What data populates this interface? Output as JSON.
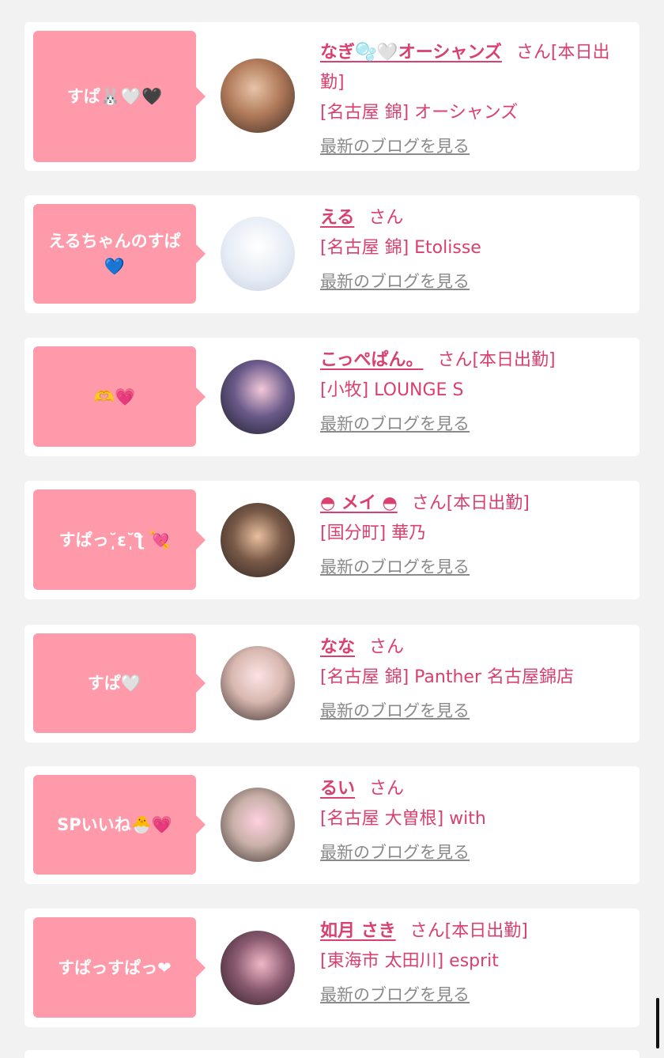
{
  "items": [
    {
      "bubble": "すぱ🐰🤍🖤",
      "name": "なぎ🫧🤍オーシャンズ",
      "san": "さん[本日出勤]",
      "shop": "[名古屋 錦] オーシャンズ",
      "blog": "最新のブログを見る"
    },
    {
      "bubble": "えるちゃんのすぱ💙",
      "name": "える",
      "san": "さん",
      "shop": "[名古屋 錦] Etolisse",
      "blog": "最新のブログを見る"
    },
    {
      "bubble": "🫶💗",
      "name": "こっぺぱん。",
      "san": "さん[本日出勤]",
      "shop": "[小牧] LOUNGE S",
      "blog": "最新のブログを見る"
    },
    {
      "bubble": "すぱっ˘̩̩̩ε˘̩ƪ 💘",
      "name": "◓ メイ ◓",
      "san": "さん[本日出勤]",
      "shop": "[国分町] 華乃",
      "blog": "最新のブログを見る"
    },
    {
      "bubble": "すぱ🤍",
      "name": "なな",
      "san": "さん",
      "shop": "[名古屋 錦] Panther 名古屋錦店",
      "blog": "最新のブログを見る"
    },
    {
      "bubble": "SPいいね🐣💗",
      "name": "るい",
      "san": "さん",
      "shop": "[名古屋 大曽根] with",
      "blog": "最新のブログを見る"
    },
    {
      "bubble": "すぱっすぱっ❤",
      "name": "如月 さき",
      "san": "さん[本日出勤]",
      "shop": "[東海市 太田川] esprit",
      "blog": "最新のブログを見る"
    }
  ],
  "colors": {
    "accent": "#d94070",
    "bubble": "#ff9aaa",
    "background": "#f2f2f2"
  }
}
